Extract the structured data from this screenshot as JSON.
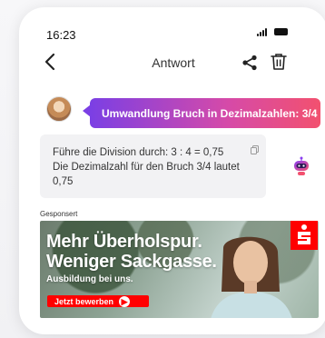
{
  "status_bar": {
    "time": "16:23"
  },
  "header": {
    "title": "Antwort"
  },
  "question": {
    "text": "Umwandlung Bruch in Dezimalzahlen: 3/4"
  },
  "answer": {
    "lines": [
      "Führe die Division durch: 3 : 4 = 0,75",
      "Die Dezimalzahl für den Bruch 3/4 lautet",
      "0,75"
    ]
  },
  "ad": {
    "label": "Gesponsert",
    "headline_1": "Mehr Überholspur.",
    "headline_2": "Weniger Sackgasse.",
    "subline": "Ausbildung bei uns.",
    "cta": "Jetzt bewerben",
    "brand_color": "#ff0000"
  },
  "colors": {
    "accent_gradient_start": "#7b3fe4",
    "accent_gradient_end": "#f2516f"
  }
}
